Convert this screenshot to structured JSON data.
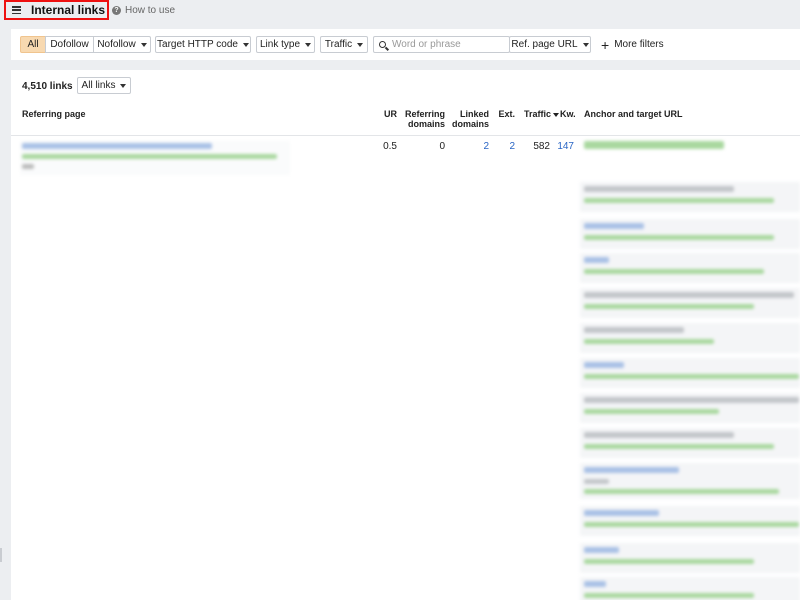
{
  "header": {
    "title": "Internal links",
    "howto_label": "How to use"
  },
  "filters": {
    "segments": [
      "All",
      "Dofollow",
      "Nofollow"
    ],
    "http_code": "Target HTTP code",
    "link_type": "Link type",
    "traffic": "Traffic",
    "search_placeholder": "Word or phrase",
    "ref_scope": "Ref. page URL",
    "more_filters": "More filters"
  },
  "summary": {
    "count": "4,510 links",
    "view": "All links"
  },
  "table": {
    "headers": {
      "referring_page": "Referring page",
      "ur": "UR",
      "ref_domains_1": "Referring",
      "ref_domains_2": "domains",
      "linked_domains_1": "Linked",
      "linked_domains_2": "domains",
      "ext": "Ext.",
      "traffic": "Traffic",
      "kw": "Kw.",
      "anchor": "Anchor and target URL"
    },
    "row": {
      "ur": "0.5",
      "ref_domains": "0",
      "linked_domains": "2",
      "ext": "2",
      "traffic": "582",
      "kw": "147"
    }
  },
  "colors": {
    "accent_active": "#f8d9b0",
    "link_blue": "#2a66c5",
    "highlight_red": "#e11"
  }
}
